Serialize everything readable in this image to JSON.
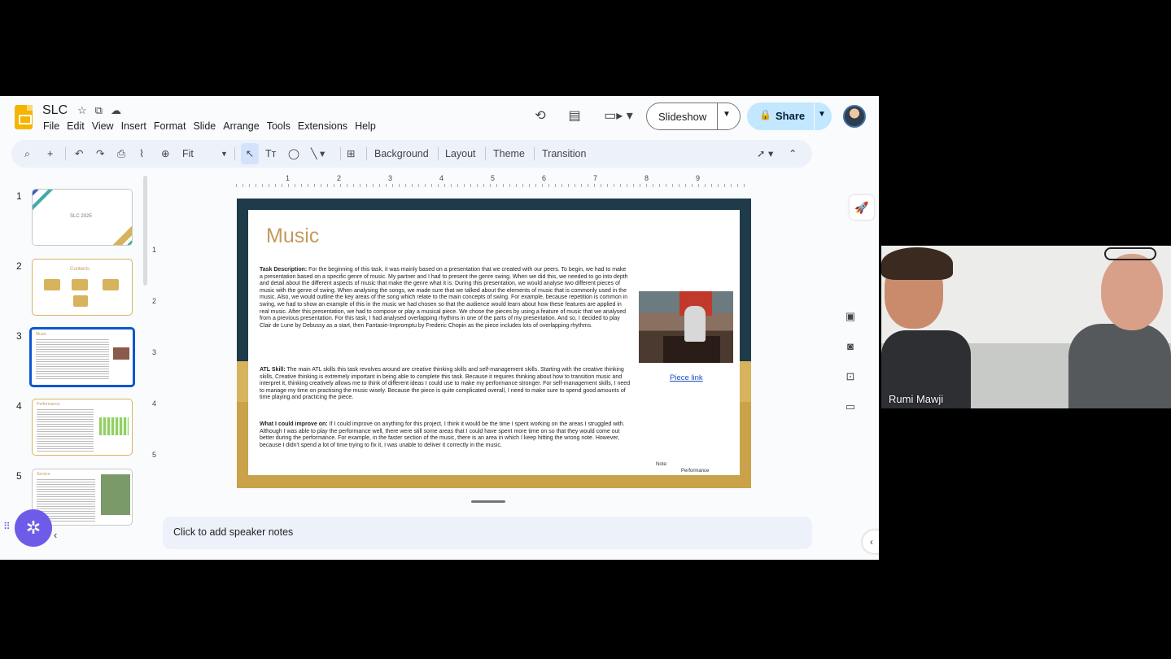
{
  "doc": {
    "title": "SLC",
    "menu": [
      "File",
      "Edit",
      "View",
      "Insert",
      "Format",
      "Slide",
      "Arrange",
      "Tools",
      "Extensions",
      "Help"
    ]
  },
  "buttons": {
    "slideshow": "Slideshow",
    "share": "Share"
  },
  "toolbar": {
    "zoom": "Fit",
    "background": "Background",
    "layout": "Layout",
    "theme": "Theme",
    "transition": "Transition"
  },
  "ruler": {
    "horizontal": [
      "1",
      "2",
      "3",
      "4",
      "5",
      "6",
      "7",
      "8",
      "9"
    ],
    "vertical": [
      "1",
      "2",
      "3",
      "4",
      "5"
    ]
  },
  "thumbnails": [
    {
      "number": "1",
      "label": "SLC 2025"
    },
    {
      "number": "2",
      "label": "Contents"
    },
    {
      "number": "3",
      "label": "Music"
    },
    {
      "number": "4",
      "label": "Performance"
    },
    {
      "number": "5",
      "label": "Service"
    }
  ],
  "slide": {
    "title": "Music",
    "task_heading": "Task Description:",
    "task_body": "For the beginning of this task, it was mainly based on a presentation that we created with our peers. To begin, we had to make a presentation based on a specific genre of music. My partner and I had to present the genre swing. When we did this, we needed to go into depth and detail about the different aspects of music that make the genre what it is. During this presentation, we would analyse two different pieces of music with the genre of swing. When analysing the songs, we made sure that we talked about the elements of music that is commonly used in the music. Also, we would outline the key areas of the song which relate to the main concepts of swing. For example, because repetition is common in swing, we had to show an example of this in the music we had chosen so that the audience would learn about how these features are applied in real music. After this presentation, we had to compose or play a musical piece. We chose the pieces by using a feature of music that we analysed from a previous presentation. For this task, I had analysed overlapping rhythms in one of the parts of my presentation. And so, I decided to play Clair de Lune by Debussy as a start, then Fantasie-Impromptu by Frederic Chopin as the piece includes lots of overlapping rhythms.",
    "atl_heading": "ATL Skill:",
    "atl_body": "The main ATL skills this task revolves around are creative thinking skills and self-management skills. Starting with the creative thinking skills, Creative thinking is extremely important in being able to complete this task. Because it requires thinking about how to transition music and interpret it, thinking creatively allows me to think of different ideas I could use to make my performance stronger. For self-management skills, I need to manage my time on practising the music wisely. Because the piece is quite complicated overall, I need to make sure to spend good amounts of time playing and practicing the piece.",
    "improve_heading": "What I could improve on:",
    "improve_body": "If I could improve on anything for this project, I think it would be the time I spent working on the areas I struggled with. Although I was able to play the performance well, there were still some areas that I could have spent more time on so that they would come out better during the performance. For example, in the faster section of the music, there is an area in which I keep hitting the wrong note. However, because I didn't spend a lot of time trying to fix it, I was unable to deliver it correctly in the music.",
    "link": "Piece link",
    "note_label": "Note:",
    "note_value": "Performance"
  },
  "speaker_notes": {
    "placeholder": "Click to add speaker notes"
  },
  "video": {
    "participant": "Rumi Mawji"
  },
  "colors": {
    "accent": "#0b57d0",
    "share_bg": "#c2e7ff",
    "slide_frame": "#1f3a48",
    "slide_gold": "#d6b35c",
    "title_color": "#c49a5c"
  }
}
